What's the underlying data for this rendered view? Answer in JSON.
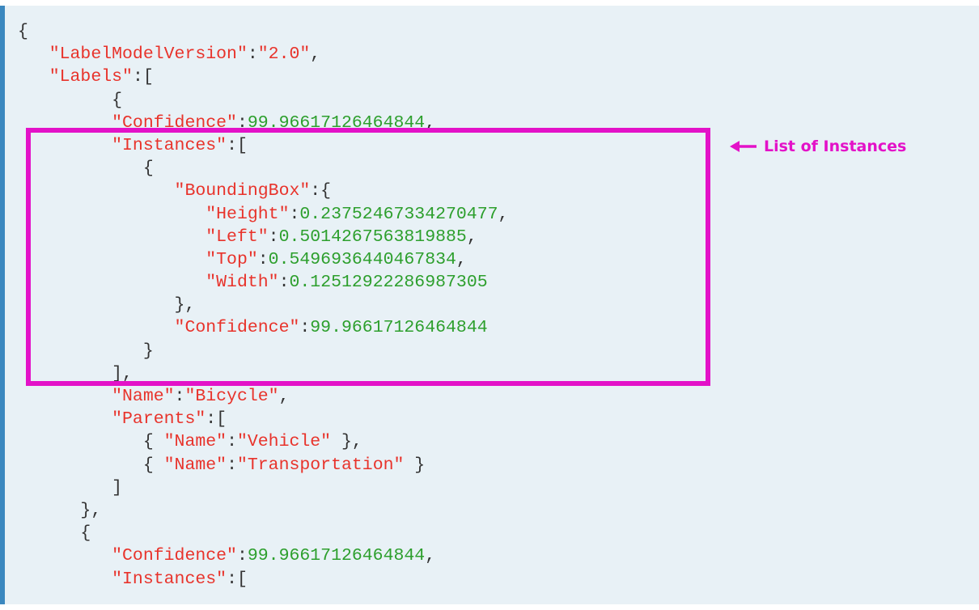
{
  "annotation": {
    "label": "List of Instances",
    "color": "#e312c8",
    "icon": "arrow-left-icon"
  },
  "colors": {
    "panel_background": "#e8f1f6",
    "panel_border": "#3b88bf",
    "key": "#e8332b",
    "number": "#2d9f2d",
    "punctuation": "#333333"
  },
  "code": {
    "lines": [
      [
        {
          "t": "p",
          "v": "{"
        }
      ],
      [
        {
          "t": "p",
          "v": "   "
        },
        {
          "t": "k",
          "v": "\"LabelModelVersion\""
        },
        {
          "t": "p",
          "v": ":"
        },
        {
          "t": "s",
          "v": "\"2.0\""
        },
        {
          "t": "p",
          "v": ","
        }
      ],
      [
        {
          "t": "p",
          "v": "   "
        },
        {
          "t": "k",
          "v": "\"Labels\""
        },
        {
          "t": "p",
          "v": ":["
        }
      ],
      [
        {
          "t": "p",
          "v": "         {"
        }
      ],
      [
        {
          "t": "p",
          "v": "         "
        },
        {
          "t": "k",
          "v": "\"Confidence\""
        },
        {
          "t": "p",
          "v": ":"
        },
        {
          "t": "n",
          "v": "99.96617126464844"
        },
        {
          "t": "p",
          "v": ","
        }
      ],
      [
        {
          "t": "p",
          "v": "         "
        },
        {
          "t": "k",
          "v": "\"Instances\""
        },
        {
          "t": "p",
          "v": ":["
        }
      ],
      [
        {
          "t": "p",
          "v": "            {"
        }
      ],
      [
        {
          "t": "p",
          "v": "               "
        },
        {
          "t": "k",
          "v": "\"BoundingBox\""
        },
        {
          "t": "p",
          "v": ":{"
        }
      ],
      [
        {
          "t": "p",
          "v": "                  "
        },
        {
          "t": "k",
          "v": "\"Height\""
        },
        {
          "t": "p",
          "v": ":"
        },
        {
          "t": "n",
          "v": "0.23752467334270477"
        },
        {
          "t": "p",
          "v": ","
        }
      ],
      [
        {
          "t": "p",
          "v": "                  "
        },
        {
          "t": "k",
          "v": "\"Left\""
        },
        {
          "t": "p",
          "v": ":"
        },
        {
          "t": "n",
          "v": "0.5014267563819885"
        },
        {
          "t": "p",
          "v": ","
        }
      ],
      [
        {
          "t": "p",
          "v": "                  "
        },
        {
          "t": "k",
          "v": "\"Top\""
        },
        {
          "t": "p",
          "v": ":"
        },
        {
          "t": "n",
          "v": "0.5496936440467834"
        },
        {
          "t": "p",
          "v": ","
        }
      ],
      [
        {
          "t": "p",
          "v": "                  "
        },
        {
          "t": "k",
          "v": "\"Width\""
        },
        {
          "t": "p",
          "v": ":"
        },
        {
          "t": "n",
          "v": "0.12512922286987305"
        }
      ],
      [
        {
          "t": "p",
          "v": "               },"
        }
      ],
      [
        {
          "t": "p",
          "v": "               "
        },
        {
          "t": "k",
          "v": "\"Confidence\""
        },
        {
          "t": "p",
          "v": ":"
        },
        {
          "t": "n",
          "v": "99.96617126464844"
        }
      ],
      [
        {
          "t": "p",
          "v": "            }"
        }
      ],
      [
        {
          "t": "p",
          "v": "         ],"
        }
      ],
      [
        {
          "t": "p",
          "v": "         "
        },
        {
          "t": "k",
          "v": "\"Name\""
        },
        {
          "t": "p",
          "v": ":"
        },
        {
          "t": "s",
          "v": "\"Bicycle\""
        },
        {
          "t": "p",
          "v": ","
        }
      ],
      [
        {
          "t": "p",
          "v": "         "
        },
        {
          "t": "k",
          "v": "\"Parents\""
        },
        {
          "t": "p",
          "v": ":["
        }
      ],
      [
        {
          "t": "p",
          "v": "            { "
        },
        {
          "t": "k",
          "v": "\"Name\""
        },
        {
          "t": "p",
          "v": ":"
        },
        {
          "t": "s",
          "v": "\"Vehicle\""
        },
        {
          "t": "p",
          "v": " },"
        }
      ],
      [
        {
          "t": "p",
          "v": "            { "
        },
        {
          "t": "k",
          "v": "\"Name\""
        },
        {
          "t": "p",
          "v": ":"
        },
        {
          "t": "s",
          "v": "\"Transportation\""
        },
        {
          "t": "p",
          "v": " }"
        }
      ],
      [
        {
          "t": "p",
          "v": "         ]"
        }
      ],
      [
        {
          "t": "p",
          "v": "      },"
        }
      ],
      [
        {
          "t": "p",
          "v": "      {"
        }
      ],
      [
        {
          "t": "p",
          "v": "         "
        },
        {
          "t": "k",
          "v": "\"Confidence\""
        },
        {
          "t": "p",
          "v": ":"
        },
        {
          "t": "n",
          "v": "99.96617126464844"
        },
        {
          "t": "p",
          "v": ","
        }
      ],
      [
        {
          "t": "p",
          "v": "         "
        },
        {
          "t": "k",
          "v": "\"Instances\""
        },
        {
          "t": "p",
          "v": ":["
        }
      ]
    ]
  }
}
